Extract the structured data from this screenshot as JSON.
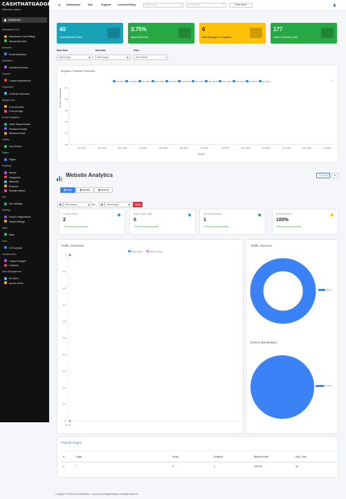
{
  "sidebar": {
    "brand": "CASHTHATGADGET",
    "welcome": "Welcome, admin",
    "active": "Dashboard",
    "sections": [
      {
        "title": "Abandoned Cart",
        "items": [
          "Abandoned Cart Settings",
          "Abandoned carts"
        ]
      },
      {
        "title": "Accounts",
        "items": [
          "Email addresses"
        ]
      },
      {
        "title": "Activation",
        "items": [
          "Activation licences"
        ]
      },
      {
        "title": "Contact",
        "items": [
          "Contact submissions"
        ]
      },
      {
        "title": "Customers",
        "items": [
          "Customer Accounts"
        ]
      },
      {
        "title": "Django Cron",
        "items": [
          "Cron job locks",
          "Cron job logs"
        ]
      },
      {
        "title": "Email Templates",
        "items": [
          "Order Status Emails",
          "Password Emails",
          "Welcome Email"
        ]
      },
      {
        "title": "Orders",
        "items": [
          "Your Orders"
        ]
      },
      {
        "title": "Pages",
        "items": [
          "Pages"
        ]
      },
      {
        "title": "Products",
        "items": [
          "Brands",
          "Categories",
          "Networks",
          "Products",
          "Storage options"
        ]
      },
      {
        "title": "Seo",
        "items": [
          "Seo Settings"
        ]
      },
      {
        "title": "Settings",
        "items": [
          "Email Configurations",
          "Global Settings"
        ]
      },
      {
        "title": "Sites",
        "items": [
          "Sites"
        ]
      },
      {
        "title": "Sync",
        "items": [
          "CSV Upload"
        ]
      },
      {
        "title": "Vouchers/Vox",
        "items": [
          "Coupon Usages",
          "Coupons"
        ]
      },
      {
        "title": "User Management",
        "items": [
          "All Users",
          "Access Roles"
        ]
      }
    ]
  },
  "topbar": {
    "nav": [
      "Dashboard",
      "Site",
      "Support",
      "License/Policy"
    ],
    "search1": "Search users...",
    "search2": "Search blogs...",
    "clear": "Clear cache"
  },
  "cards": [
    {
      "value": "40",
      "label": "New Buyback Orders",
      "color": "#17a2b8"
    },
    {
      "value": "3.75%",
      "label": "Abandoned Cart",
      "color": "#28a745"
    },
    {
      "value": "6",
      "label": "New Messages or Inquiries",
      "color": "#ffc107"
    },
    {
      "value": "177",
      "label": "Active Customers (All)",
      "color": "#28a745"
    }
  ],
  "filters": {
    "start_label": "Start Date",
    "end_label": "End Date",
    "filter_label": "Filter",
    "start_placeholder": "dd/mm/yyyy",
    "end_placeholder": "dd/mm/yyyy",
    "filter_value": "All Products"
  },
  "timeline": {
    "title": "Buyback Timeline Overview",
    "ylabel": "Number of Buybacks",
    "xlabel": "Months",
    "legend": [
      "Jul 2021",
      "Jul 2022",
      "Feb 2023",
      "Mar 2023",
      "Jul 2023",
      "Feb 2024",
      "Jun 2024",
      "Dec 2024",
      "Feb 2025",
      "Oct 2024",
      "Jul 2024",
      "Apr 2024"
    ],
    "yticks": [
      "1.0",
      "0.8",
      "0.6",
      "0.4",
      "0.2",
      "0.0"
    ],
    "xticks": [
      "Jul 2023",
      "Jan 2023",
      "May 2023",
      "Jul 2023",
      "Mar 2024",
      "Feb 2024",
      "Jul 2024",
      "Jul 2025",
      "Dec 2024",
      "Jun 2025",
      "Oct 2024",
      "Sep 2024",
      "Jul 2024"
    ]
  },
  "analytics": {
    "title": "Website Analytics",
    "export": "Export",
    "tabs": [
      "Daily",
      "Weekly",
      "Monthly"
    ],
    "date_from": "dd/mm/yyyy",
    "date_to": "dd/mm/yyyy",
    "apply": "Apply",
    "metrics": [
      {
        "title": "TOTAL VISITS",
        "value": "2",
        "change": "0% from previous period",
        "dot": "#3b82f6"
      },
      {
        "title": "PAGE VIEW TIME",
        "value": "0",
        "change": "0% from previous period",
        "dot": "#17a2b8"
      },
      {
        "title": "PAGES/SESSION",
        "value": "1",
        "change": "0% from previous period",
        "dot": "#28a745"
      },
      {
        "title": "BOUNCE RATE",
        "value": "100%",
        "change": "0% from previous period",
        "dot": "#ffc107"
      }
    ],
    "traffic_overview": {
      "title": "Traffic Overview",
      "legend": [
        "Page Views",
        "Unique Visitors"
      ]
    },
    "traffic_sources": {
      "title": "Traffic Sources",
      "legend": "direct"
    },
    "device": {
      "title": "Device Breakdown",
      "legend": "desktop"
    }
  },
  "chart_data": [
    {
      "type": "bar",
      "title": "Buyback Timeline Overview",
      "xlabel": "Months",
      "ylabel": "Number of Buybacks",
      "ylim": [
        0,
        1
      ],
      "categories": [
        "Jul 2023",
        "Jan 2023",
        "May 2023",
        "Jul 2023",
        "Mar 2024",
        "Feb 2024",
        "Jul 2024",
        "Jul 2025",
        "Dec 2024",
        "Jun 2025",
        "Oct 2024",
        "Sep 2024",
        "Jul 2024"
      ],
      "series": []
    },
    {
      "type": "line",
      "title": "Traffic Overview",
      "ylim": [
        0,
        1.0
      ],
      "y_ticks": [
        "1",
        "0.9",
        "0.8",
        "0.7",
        "0.6",
        "0.5",
        "0.4",
        "0.3",
        "0.2",
        "0.1",
        "0"
      ],
      "x": [
        "Jul 10"
      ],
      "series": [
        {
          "name": "Page Views",
          "values": [
            1
          ]
        },
        {
          "name": "Unique Visitors",
          "values": [
            0
          ]
        }
      ]
    },
    {
      "type": "pie",
      "title": "Traffic Sources",
      "labels": [
        "direct"
      ],
      "values": [
        100
      ]
    },
    {
      "type": "pie",
      "title": "Device Breakdown",
      "labels": [
        "desktop"
      ],
      "values": [
        100
      ]
    }
  ],
  "popular": {
    "title": "Popular Pages",
    "headers": [
      "#",
      "Page",
      "Visits",
      "Uniques",
      "Bounce Rate",
      "Avg. Time"
    ],
    "rows": [
      [
        "1",
        "/",
        "2",
        "2",
        "100.0%",
        "0s"
      ]
    ]
  },
  "footer": "Copyright © 2025 Buy Back/Repair - A product by BeigeaDesigns. All rights reserved."
}
